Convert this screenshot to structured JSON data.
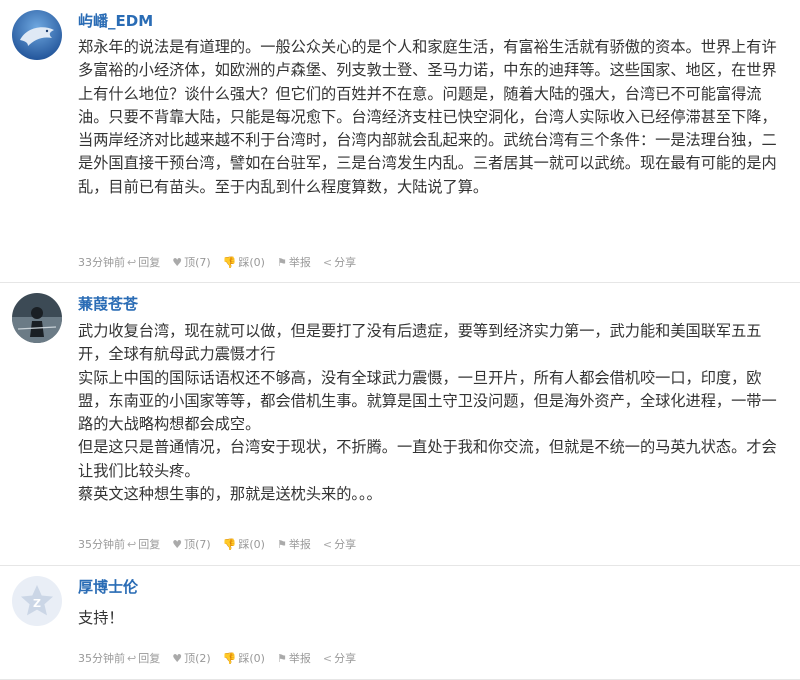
{
  "comments": [
    {
      "user": "屿嶓_EDM",
      "avatar_icon": "dolphin-avatar",
      "paragraphs": [
        "郑永年的说法是有道理的。一般公众关心的是个人和家庭生活，有富裕生活就有骄傲的资本。世界上有许多富裕的小经济体，如欧洲的卢森堡、列支敦士登、圣马力诺，中东的迪拜等。这些国家、地区，在世界上有什么地位？谈什么强大？但它们的百姓并不在意。问题是，随着大陆的强大，台湾已不可能富得流油。只要不背靠大陆，只能是每况愈下。台湾经济支柱已快空洞化，台湾人实际收入已经停滞甚至下降，当两岸经济对比越来越不利于台湾时，台湾内部就会乱起来的。武统台湾有三个条件：一是法理台独，二是外国直接干预台湾，譬如在台驻军，三是台湾发生内乱。三者居其一就可以武统。现在最有可能的是内乱，目前已有苗头。至于内乱到什么程度算数，大陆说了算。"
      ],
      "time": "33分钟前",
      "reply": "回复",
      "up": "顶(7)",
      "down": "踩(0)",
      "report": "举报",
      "share": "分享"
    },
    {
      "user": "蒹葭苍苍",
      "avatar_icon": "figure-photo-avatar",
      "paragraphs": [
        "武力收复台湾，现在就可以做，但是要打了没有后遗症，要等到经济实力第一，武力能和美国联军五五开，全球有航母武力震慑才行",
        "实际上中国的国际话语权还不够高，没有全球武力震慑，一旦开片，所有人都会借机咬一口，印度，欧盟，东南亚的小国家等等，都会借机生事。就算是国土守卫没问题，但是海外资产，全球化进程，一带一路的大战略构想都会成空。",
        "但是这只是普通情况，台湾安于现状，不折腾。一直处于我和你交流，但就是不统一的马英九状态。才会让我们比较头疼。",
        "蔡英文这种想生事的，那就是送枕头来的。。。"
      ],
      "time": "35分钟前",
      "reply": "回复",
      "up": "顶(7)",
      "down": "踩(0)",
      "report": "举报",
      "share": "分享"
    },
    {
      "user": "厚博士伦",
      "avatar_icon": "default-star-avatar",
      "paragraphs": [
        "支持！"
      ],
      "time": "35分钟前",
      "reply": "回复",
      "up": "顶(2)",
      "down": "踩(0)",
      "report": "举报",
      "share": "分享"
    }
  ],
  "colors": {
    "username": "#2a6cb5",
    "meta": "#999999",
    "divider": "#e6e6e6"
  }
}
